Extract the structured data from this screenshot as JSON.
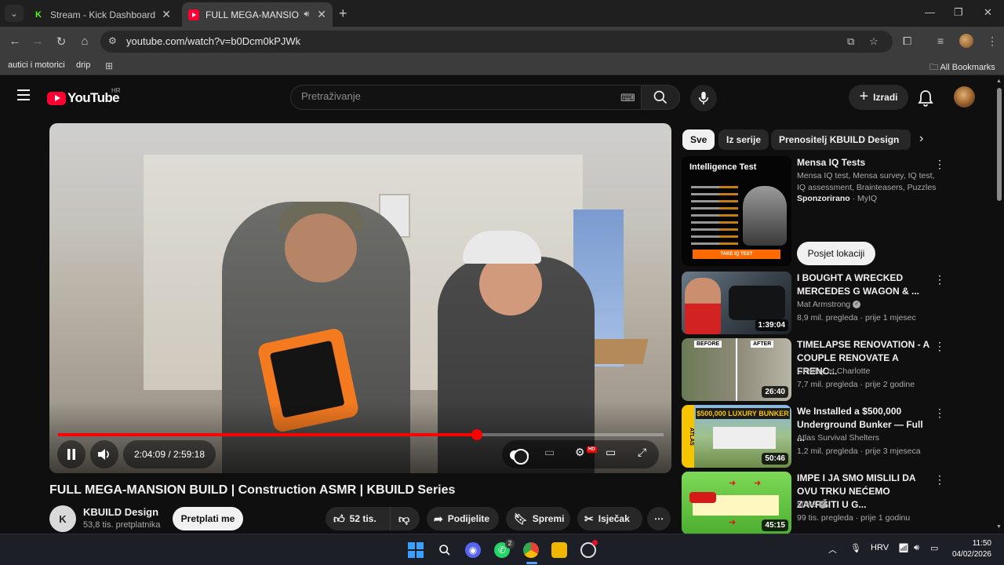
{
  "browser": {
    "tabs": [
      {
        "title": "Stream - Kick Dashboard",
        "favicon": "kick-icon",
        "active": false
      },
      {
        "title": "FULL MEGA-MANSION BUIL",
        "favicon": "youtube-icon",
        "active": true
      }
    ],
    "url": "youtube.com/watch?v=b0Dcm0kPJWk",
    "bookmarks": [
      "autici i motorici",
      "drip"
    ],
    "all_bookmarks": "All Bookmarks"
  },
  "youtube": {
    "country": "HR",
    "logo_text": "YouTube",
    "search_placeholder": "Pretraživanje",
    "create_label": "Izradi"
  },
  "player": {
    "time_current": "2:04:09",
    "time_total": "2:59:18",
    "time_display": "2:04:09 / 2:59:18",
    "progress_fraction": 0.692,
    "hd_badge": "HD"
  },
  "video": {
    "title": "FULL MEGA-MANSION BUILD | Construction ASMR | KBUILD Series",
    "channel_name": "KBUILD Design",
    "channel_initials": "K",
    "subscribers": "53,8 tis. pretplatnika",
    "subscribe_label": "Pretplati me",
    "likes": "52 tis.",
    "share_label": "Podijelite",
    "save_label": "Spremi",
    "clip_label": "Isječak"
  },
  "chips": [
    "Sve",
    "Iz serije",
    "Prenositelj KBUILD Design"
  ],
  "recommendations": [
    {
      "title": "Mensa IQ Tests",
      "description": "Mensa IQ test, Mensa survey, IQ test, IQ assessment, Brainteasers, Puzzles",
      "sponsored": "Sponzorirano",
      "advertiser": "MyIQ",
      "cta": "Posjet lokaciji",
      "thumb_heading": "Intelligence Test",
      "thumb_button": "TAKE IQ TEST"
    },
    {
      "title": "I BOUGHT A WRECKED MERCEDES G WAGON & ...",
      "channel": "Mat Armstrong",
      "verified": true,
      "views": "8,9 mil. pregleda",
      "age": "prije 1 mjesec",
      "duration": "1:39:04"
    },
    {
      "title": "TIMELAPSE  RENOVATION - A COUPLE RENOVATE A FRENC...",
      "channel": "Charley et Charlotte",
      "verified": false,
      "views": "7,7 mil. pregleda",
      "age": "prije 2 godine",
      "duration": "26:40",
      "thumb_before": "BEFORE",
      "thumb_after": "AFTER"
    },
    {
      "title": "We Installed a $500,000 Underground Bunker — Full ...",
      "channel": "Atlas Survival Shelters",
      "verified": false,
      "views": "1,2 mil. pregleda",
      "age": "prije 3 mjeseca",
      "duration": "50:46",
      "thumb_banner": "$500,000 LUXURY BUNKER",
      "thumb_side": "ATLAS"
    },
    {
      "title": "IMPE I JA SMO MISLILI DA OVU TRKU NEĆEMO ZAVRŠITI U G...",
      "channel": "50N3",
      "verified": true,
      "views": "99 tis. pregleda",
      "age": "prije 1 godinu",
      "duration": "45:15"
    }
  ],
  "taskbar": {
    "whatsapp_badge": "2",
    "language": "HRV",
    "time": "11:50",
    "date": "04/02/2026"
  }
}
